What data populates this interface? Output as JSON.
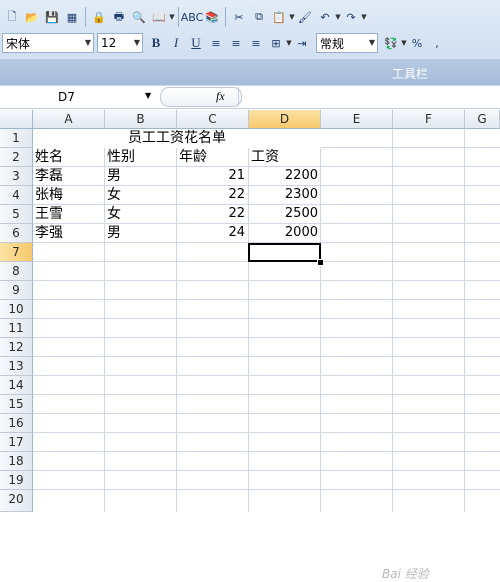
{
  "toolbar": {
    "font_name": "宋体",
    "font_size": "12",
    "number_format": "常规",
    "caption": "工具栏",
    "percent_label": "%",
    "comma_label": ","
  },
  "formula_bar": {
    "name_box": "D7",
    "fx_label": "fx",
    "formula": ""
  },
  "columns": [
    "A",
    "B",
    "C",
    "D",
    "E",
    "F",
    "G"
  ],
  "rows": [
    "1",
    "2",
    "3",
    "4",
    "5",
    "6",
    "7",
    "8",
    "9",
    "10",
    "11",
    "12",
    "13",
    "14",
    "15",
    "16",
    "17",
    "18",
    "19",
    "20"
  ],
  "sheet": {
    "title": "员工工资花名单",
    "headers": [
      "姓名",
      "性别",
      "年龄",
      "工资"
    ],
    "records": [
      {
        "name": "李磊",
        "gender": "男",
        "age": "21",
        "salary": "2200"
      },
      {
        "name": "张梅",
        "gender": "女",
        "age": "22",
        "salary": "2300"
      },
      {
        "name": "王雪",
        "gender": "女",
        "age": "22",
        "salary": "2500"
      },
      {
        "name": "李强",
        "gender": "男",
        "age": "24",
        "salary": "2000"
      }
    ]
  },
  "selected_cell": "D7",
  "watermark": "Bai 经验"
}
